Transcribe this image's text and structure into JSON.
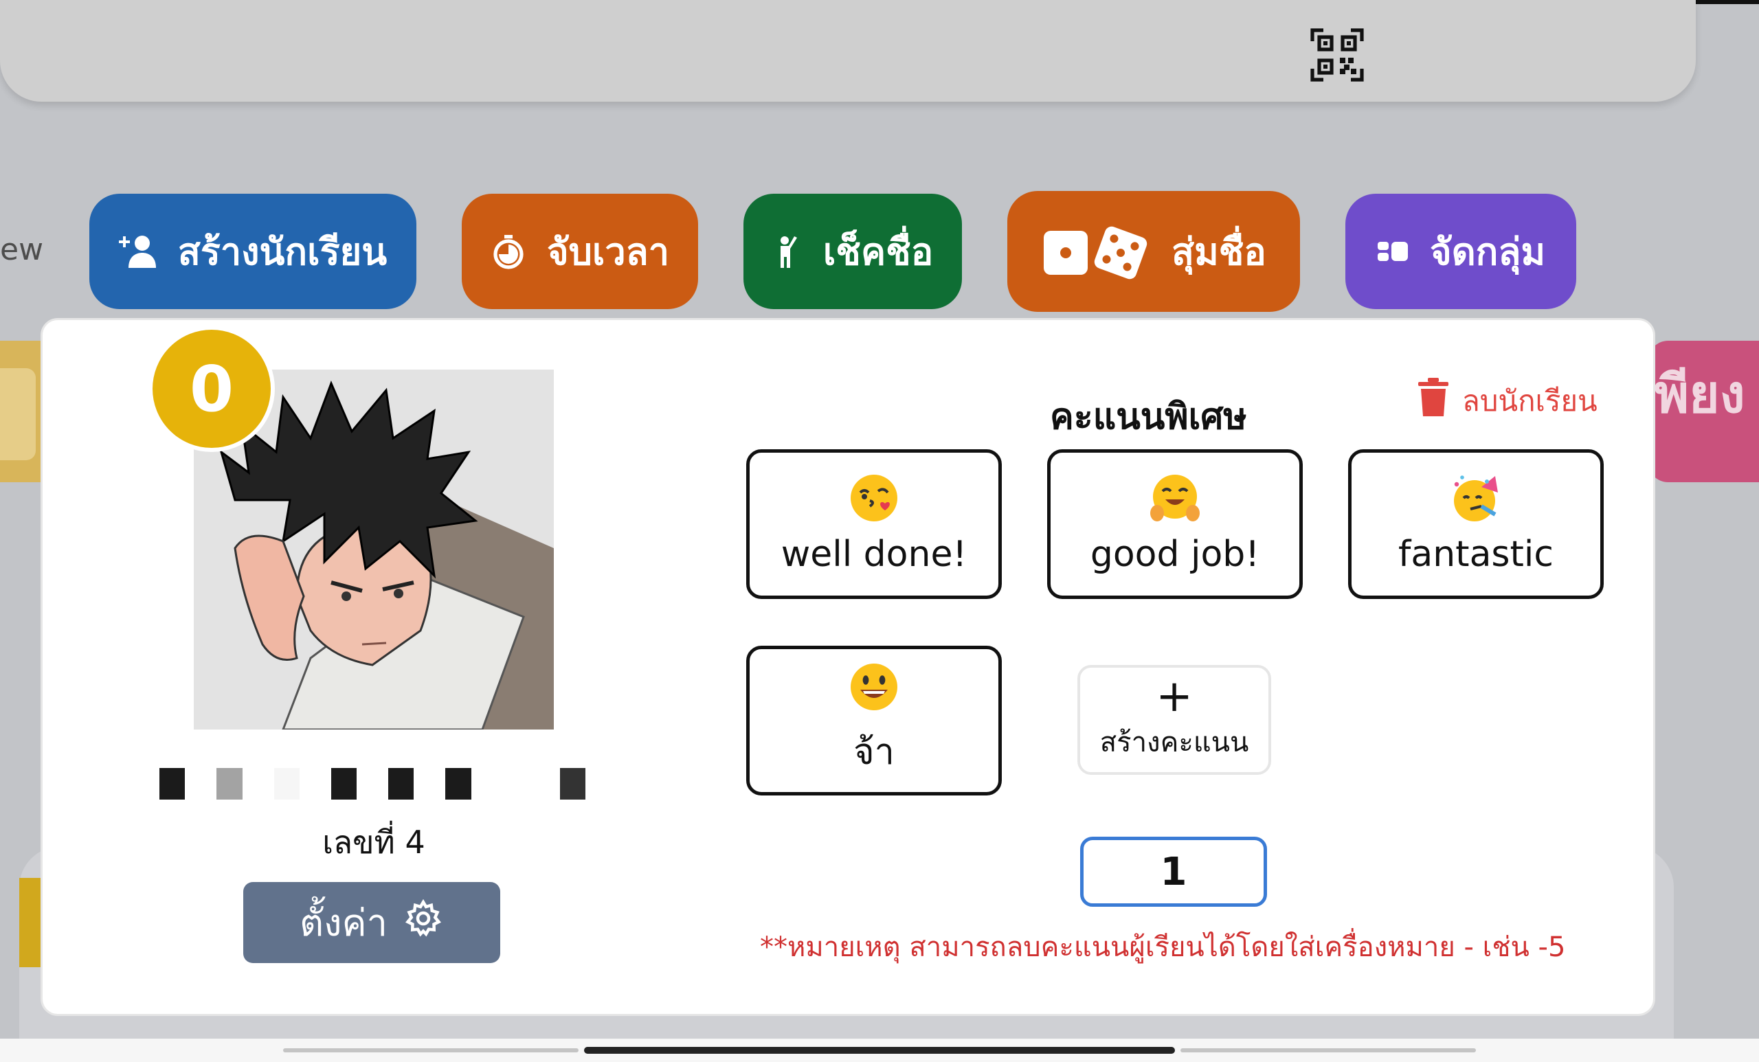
{
  "header": {
    "qr_icon": "qr-code-icon"
  },
  "toolbar": {
    "view_partial": "ew",
    "create_students": "สร้างนักเรียน",
    "timer": "จับเวลา",
    "attendance": "เช็คชื่อ",
    "random_name": "สุ่มชื่อ",
    "group": "จัดกลุ่ม"
  },
  "background_card_right_partial": "พียง",
  "student": {
    "score": "0",
    "number_label": "เลขที่ 4",
    "settings_label": "ตั้งค่า"
  },
  "bonus": {
    "title": "คะแนนพิเศษ",
    "delete_label": "ลบนักเรียน",
    "rewards": [
      {
        "label": "well done!",
        "icon": "kiss-face-icon"
      },
      {
        "label": "good job!",
        "icon": "hug-face-icon"
      },
      {
        "label": "fantastic",
        "icon": "party-face-icon"
      },
      {
        "label": "จ้า",
        "icon": "grin-face-icon"
      }
    ],
    "add_plus": "+",
    "add_label": "สร้างคะแนน",
    "amount_value": "1",
    "note": "**หมายเหตุ สามารถลบคะแนนผู้เรียนได้โดยใส่เครื่องหมาย - เช่น -5"
  },
  "colors": {
    "blue": "#2365ae",
    "orange": "#cb5b13",
    "green": "#0f6e34",
    "purple": "#6f4dcb",
    "badge": "#e6b30a",
    "settings": "#61728c",
    "danger": "#e0453f"
  }
}
